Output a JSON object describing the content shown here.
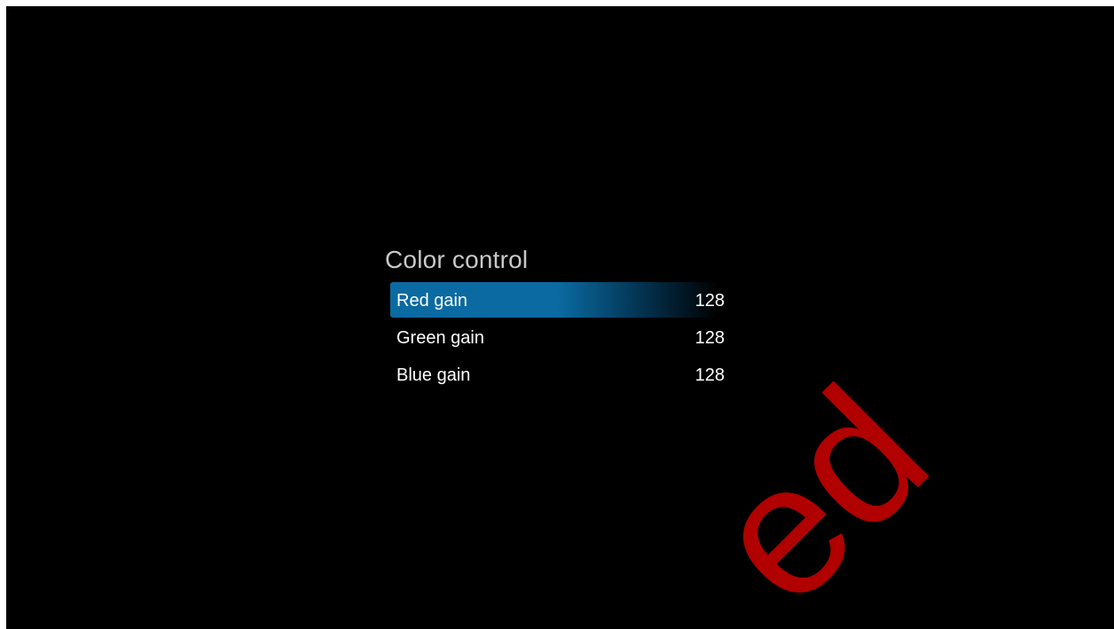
{
  "settings_panel": {
    "title": "Color control",
    "items": [
      {
        "label": "Red gain",
        "value": "128",
        "focused": true
      },
      {
        "label": "Green gain",
        "value": "128",
        "focused": false
      },
      {
        "label": "Blue gain",
        "value": "128",
        "focused": false
      }
    ]
  },
  "watermark": {
    "text": "ed"
  },
  "colors": {
    "background": "#000000",
    "focus_highlight": "#0a6aa1",
    "title_text": "#c8c8c8",
    "item_text": "#ffffff",
    "watermark": "#b00000"
  }
}
